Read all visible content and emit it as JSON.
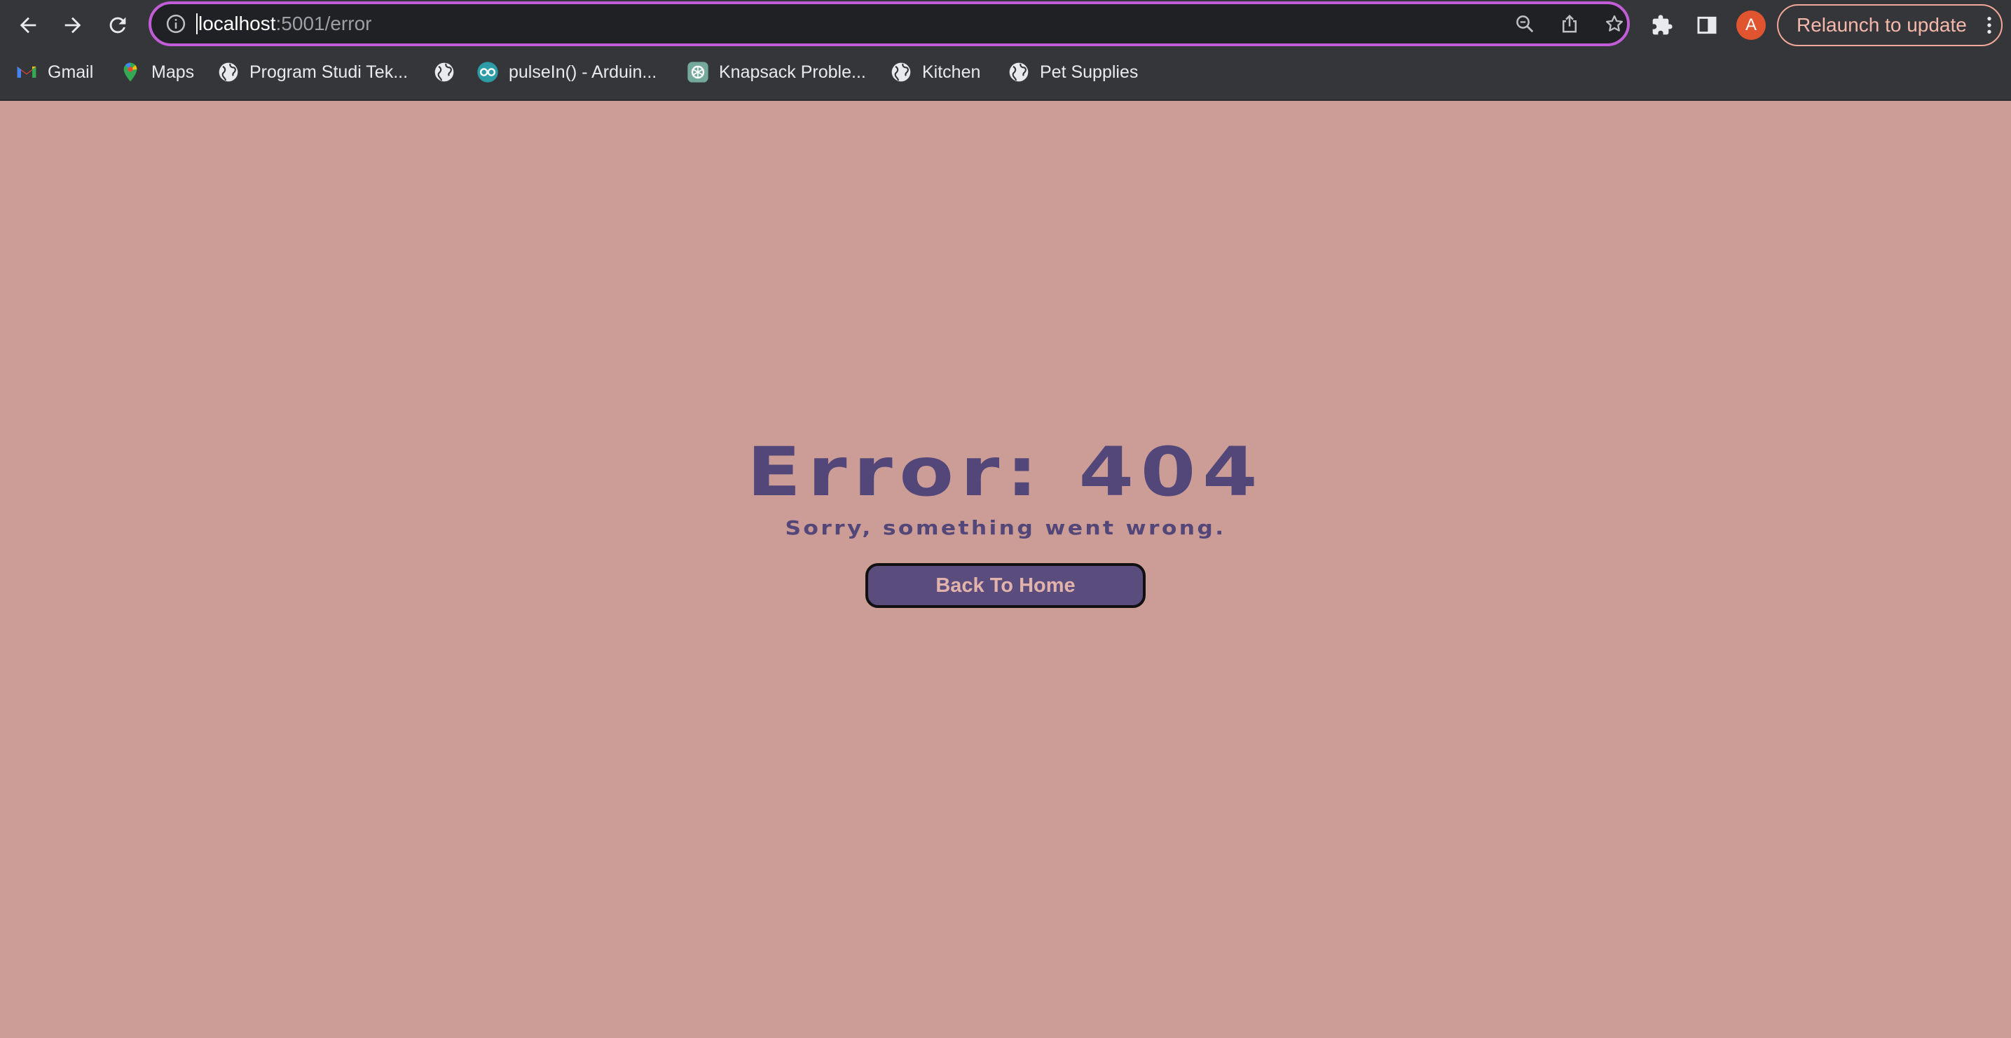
{
  "browser": {
    "url_host": "localhost",
    "url_path": ":5001/error",
    "profile_initial": "A",
    "relaunch_label": "Relaunch to update",
    "accent_colors": {
      "focus_ring": "#c15dd6",
      "profile": "#e0552f"
    },
    "icons": [
      "back-arrow-icon",
      "forward-arrow-icon",
      "reload-icon",
      "info-icon",
      "zoom-icon",
      "share-icon",
      "star-icon",
      "extensions-icon",
      "side-panel-icon",
      "kebab-menu-icon"
    ]
  },
  "bookmarks": [
    {
      "label": "Gmail",
      "icon": "gmail-icon"
    },
    {
      "label": "Maps",
      "icon": "maps-pin-icon"
    },
    {
      "label": "Program Studi Tek...",
      "icon": "globe-icon"
    },
    {
      "label": "",
      "icon": "globe-icon"
    },
    {
      "label": "pulseIn() - Arduin...",
      "icon": "arduino-icon"
    },
    {
      "label": "Knapsack Proble...",
      "icon": "chatgpt-icon"
    },
    {
      "label": "Kitchen",
      "icon": "globe-icon"
    },
    {
      "label": "Pet Supplies",
      "icon": "globe-icon"
    }
  ],
  "page": {
    "title": "Error: 404",
    "subtitle": "Sorry, something went wrong.",
    "home_button_label": "Back To Home",
    "colors": {
      "background": "#cb9d96",
      "text": "#534679",
      "button_fill": "#5b4c7e",
      "button_text": "#e2b3ab"
    }
  }
}
